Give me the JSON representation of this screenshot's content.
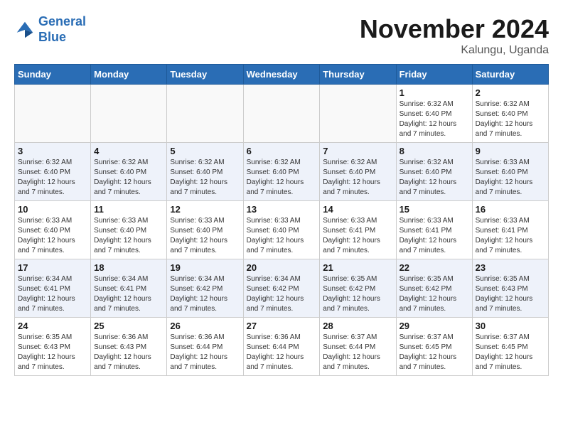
{
  "header": {
    "logo_line1": "General",
    "logo_line2": "Blue",
    "month_title": "November 2024",
    "location": "Kalungu, Uganda"
  },
  "weekdays": [
    "Sunday",
    "Monday",
    "Tuesday",
    "Wednesday",
    "Thursday",
    "Friday",
    "Saturday"
  ],
  "weeks": [
    [
      {
        "day": "",
        "info": ""
      },
      {
        "day": "",
        "info": ""
      },
      {
        "day": "",
        "info": ""
      },
      {
        "day": "",
        "info": ""
      },
      {
        "day": "",
        "info": ""
      },
      {
        "day": "1",
        "info": "Sunrise: 6:32 AM\nSunset: 6:40 PM\nDaylight: 12 hours and 7 minutes."
      },
      {
        "day": "2",
        "info": "Sunrise: 6:32 AM\nSunset: 6:40 PM\nDaylight: 12 hours and 7 minutes."
      }
    ],
    [
      {
        "day": "3",
        "info": "Sunrise: 6:32 AM\nSunset: 6:40 PM\nDaylight: 12 hours and 7 minutes."
      },
      {
        "day": "4",
        "info": "Sunrise: 6:32 AM\nSunset: 6:40 PM\nDaylight: 12 hours and 7 minutes."
      },
      {
        "day": "5",
        "info": "Sunrise: 6:32 AM\nSunset: 6:40 PM\nDaylight: 12 hours and 7 minutes."
      },
      {
        "day": "6",
        "info": "Sunrise: 6:32 AM\nSunset: 6:40 PM\nDaylight: 12 hours and 7 minutes."
      },
      {
        "day": "7",
        "info": "Sunrise: 6:32 AM\nSunset: 6:40 PM\nDaylight: 12 hours and 7 minutes."
      },
      {
        "day": "8",
        "info": "Sunrise: 6:32 AM\nSunset: 6:40 PM\nDaylight: 12 hours and 7 minutes."
      },
      {
        "day": "9",
        "info": "Sunrise: 6:33 AM\nSunset: 6:40 PM\nDaylight: 12 hours and 7 minutes."
      }
    ],
    [
      {
        "day": "10",
        "info": "Sunrise: 6:33 AM\nSunset: 6:40 PM\nDaylight: 12 hours and 7 minutes."
      },
      {
        "day": "11",
        "info": "Sunrise: 6:33 AM\nSunset: 6:40 PM\nDaylight: 12 hours and 7 minutes."
      },
      {
        "day": "12",
        "info": "Sunrise: 6:33 AM\nSunset: 6:40 PM\nDaylight: 12 hours and 7 minutes."
      },
      {
        "day": "13",
        "info": "Sunrise: 6:33 AM\nSunset: 6:40 PM\nDaylight: 12 hours and 7 minutes."
      },
      {
        "day": "14",
        "info": "Sunrise: 6:33 AM\nSunset: 6:41 PM\nDaylight: 12 hours and 7 minutes."
      },
      {
        "day": "15",
        "info": "Sunrise: 6:33 AM\nSunset: 6:41 PM\nDaylight: 12 hours and 7 minutes."
      },
      {
        "day": "16",
        "info": "Sunrise: 6:33 AM\nSunset: 6:41 PM\nDaylight: 12 hours and 7 minutes."
      }
    ],
    [
      {
        "day": "17",
        "info": "Sunrise: 6:34 AM\nSunset: 6:41 PM\nDaylight: 12 hours and 7 minutes."
      },
      {
        "day": "18",
        "info": "Sunrise: 6:34 AM\nSunset: 6:41 PM\nDaylight: 12 hours and 7 minutes."
      },
      {
        "day": "19",
        "info": "Sunrise: 6:34 AM\nSunset: 6:42 PM\nDaylight: 12 hours and 7 minutes."
      },
      {
        "day": "20",
        "info": "Sunrise: 6:34 AM\nSunset: 6:42 PM\nDaylight: 12 hours and 7 minutes."
      },
      {
        "day": "21",
        "info": "Sunrise: 6:35 AM\nSunset: 6:42 PM\nDaylight: 12 hours and 7 minutes."
      },
      {
        "day": "22",
        "info": "Sunrise: 6:35 AM\nSunset: 6:42 PM\nDaylight: 12 hours and 7 minutes."
      },
      {
        "day": "23",
        "info": "Sunrise: 6:35 AM\nSunset: 6:43 PM\nDaylight: 12 hours and 7 minutes."
      }
    ],
    [
      {
        "day": "24",
        "info": "Sunrise: 6:35 AM\nSunset: 6:43 PM\nDaylight: 12 hours and 7 minutes."
      },
      {
        "day": "25",
        "info": "Sunrise: 6:36 AM\nSunset: 6:43 PM\nDaylight: 12 hours and 7 minutes."
      },
      {
        "day": "26",
        "info": "Sunrise: 6:36 AM\nSunset: 6:44 PM\nDaylight: 12 hours and 7 minutes."
      },
      {
        "day": "27",
        "info": "Sunrise: 6:36 AM\nSunset: 6:44 PM\nDaylight: 12 hours and 7 minutes."
      },
      {
        "day": "28",
        "info": "Sunrise: 6:37 AM\nSunset: 6:44 PM\nDaylight: 12 hours and 7 minutes."
      },
      {
        "day": "29",
        "info": "Sunrise: 6:37 AM\nSunset: 6:45 PM\nDaylight: 12 hours and 7 minutes."
      },
      {
        "day": "30",
        "info": "Sunrise: 6:37 AM\nSunset: 6:45 PM\nDaylight: 12 hours and 7 minutes."
      }
    ]
  ]
}
